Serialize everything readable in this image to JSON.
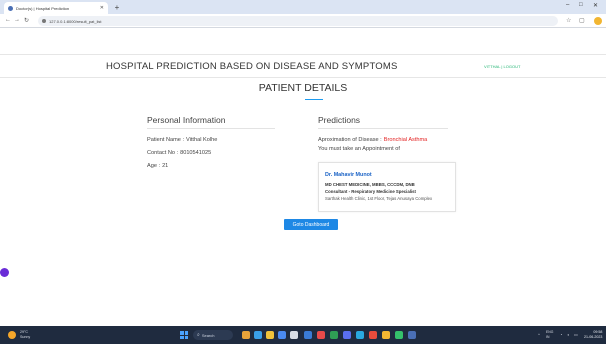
{
  "browser": {
    "tab_title": "Doctor(s) | Hospital Prediction",
    "url": "127.0.0.1:8000/result_pat_list",
    "minimize": "–",
    "maximize": "□",
    "close": "✕"
  },
  "header": {
    "title": "HOSPITAL PREDICTION BASED ON DISEASE AND SYMPTOMS",
    "logout": "VITTHAL | LOGOUT"
  },
  "page": {
    "section_title": "PATIENT DETAILS"
  },
  "personal_info": {
    "heading": "Personal Information",
    "name_label": "Patient Name :",
    "name": "Vitthal Kolhe",
    "contact_label": "Contact No :",
    "contact": "8010541025",
    "age_label": "Age :",
    "age": "21"
  },
  "predictions": {
    "heading": "Predictions",
    "disease_label": "Aproximation of Disease :",
    "disease": "Bronchial Asthma",
    "appointment_text": "You must take an Appointment of",
    "doctor": {
      "name": "Dr. Mahavir Munot",
      "qualification": "MD CHEST MEDICINE, MBBS, CCCDM, DNB",
      "role": "Consultant - Respiratory Medicine Specialist",
      "clinic": "Sarthak Health Clinic, 1st Floor, Tejas Anusaya Complex"
    }
  },
  "actions": {
    "dashboard_button": "Goto Dashboard"
  },
  "taskbar": {
    "temperature": "29°C",
    "weather": "Sunny",
    "search": "Search",
    "lang": "ENG",
    "region": "IN",
    "time": "09:58",
    "date": "21-06-2023"
  }
}
